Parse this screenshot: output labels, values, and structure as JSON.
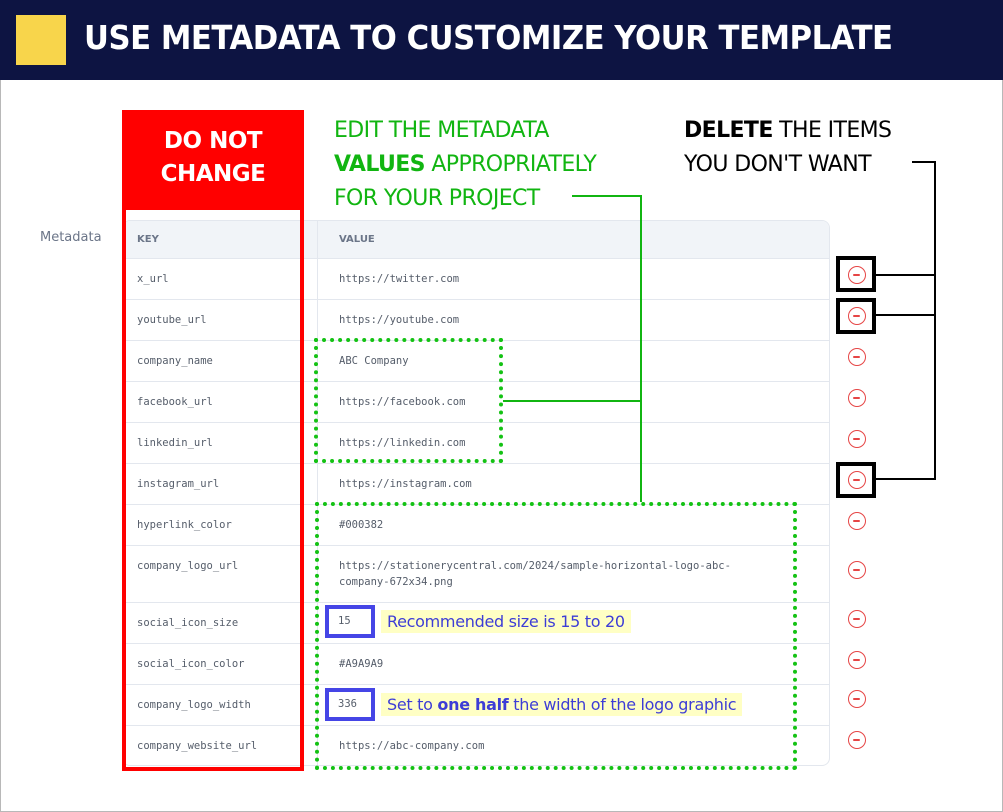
{
  "banner": {
    "title": "USE METADATA TO CUSTOMIZE YOUR TEMPLATE",
    "accent_color": "#F8D54B",
    "background_color": "#0D1442"
  },
  "section_label": "Metadata",
  "table": {
    "headers": {
      "key": "KEY",
      "value": "VALUE"
    },
    "rows": [
      {
        "key": "x_url",
        "value": "https://twitter.com"
      },
      {
        "key": "youtube_url",
        "value": "https://youtube.com"
      },
      {
        "key": "company_name",
        "value": "ABC Company"
      },
      {
        "key": "facebook_url",
        "value": "https://facebook.com"
      },
      {
        "key": "linkedin_url",
        "value": "https://linkedin.com"
      },
      {
        "key": "instagram_url",
        "value": "https://instagram.com"
      },
      {
        "key": "hyperlink_color",
        "value": "#000382"
      },
      {
        "key": "company_logo_url",
        "value": "https://stationerycentral.com/2024/sample-horizontal-logo-abc-company-672x34.png",
        "value_line1": "https://stationerycentral.com/2024/sample-horizontal-logo-abc-",
        "value_line2": "company-672x34.png"
      },
      {
        "key": "social_icon_size",
        "value": "15"
      },
      {
        "key": "social_icon_color",
        "value": "#A9A9A9"
      },
      {
        "key": "company_logo_width",
        "value": "336"
      },
      {
        "key": "company_website_url",
        "value": "https://abc-company.com"
      }
    ],
    "delete_icon": "minus-circle-icon"
  },
  "annotations": {
    "do_not_change": {
      "line1": "DO NOT",
      "line2": "CHANGE",
      "color": "#FF0000"
    },
    "edit_values": {
      "line1": "EDIT THE METADATA",
      "line2_bold": "VALUES",
      "line2_rest": " APPROPRIATELY",
      "line3": "FOR YOUR PROJECT",
      "color": "#11B511"
    },
    "delete_items": {
      "line1_bold": "DELETE",
      "line1_rest": " THE ITEMS",
      "line2": "YOU DON'T WANT"
    },
    "icon_size_hint": "Recommended size is 15 to 20",
    "logo_width_hint": {
      "pre": "Set to ",
      "bold": "one half",
      "post": " the width of the logo graphic"
    }
  }
}
